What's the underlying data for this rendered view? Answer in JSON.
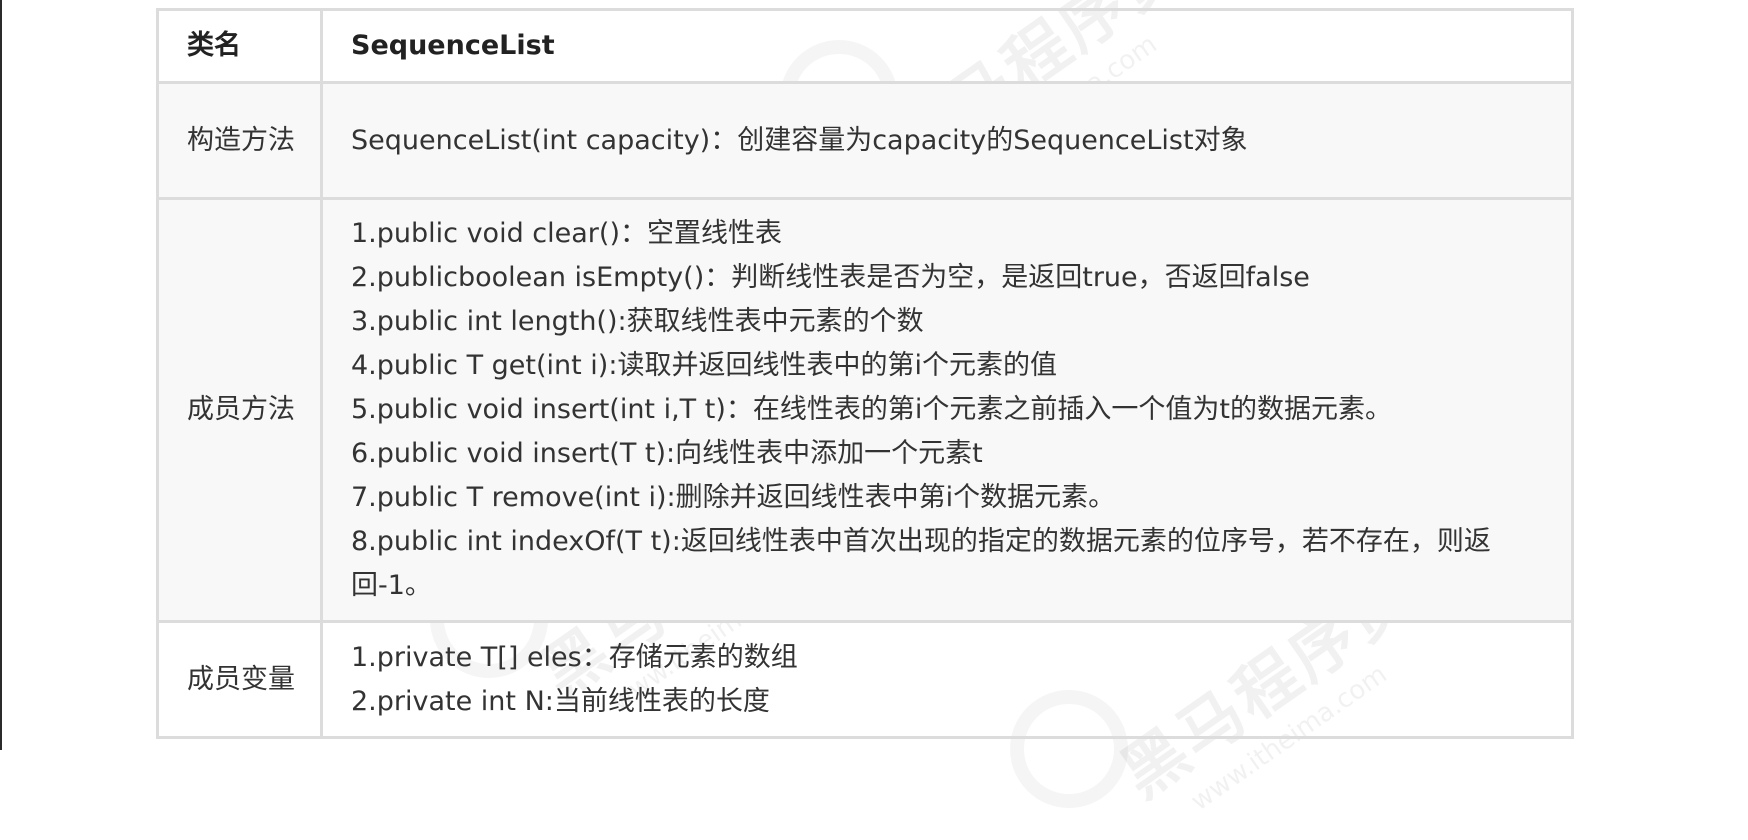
{
  "table": {
    "header": {
      "label": "类名",
      "value": "SequenceList"
    },
    "constructor": {
      "label": "构造方法",
      "value": "SequenceList(int capacity)：创建容量为capacity的SequenceList对象"
    },
    "methods": {
      "label": "成员方法",
      "lines": [
        "1.public void clear()：空置线性表",
        "2.publicboolean isEmpty()：判断线性表是否为空，是返回true，否返回false",
        "3.public int length():获取线性表中元素的个数",
        "4.public T get(int i):读取并返回线性表中的第i个元素的值",
        "5.public void insert(int i,T t)：在线性表的第i个元素之前插入一个值为t的数据元素。",
        "6.public void insert(T t):向线性表中添加一个元素t",
        "7.public T remove(int i):删除并返回线性表中第i个数据元素。",
        "8.public int indexOf(T t):返回线性表中首次出现的指定的数据元素的位序号，若不存在，则返回-1。"
      ]
    },
    "fields": {
      "label": "成员变量",
      "lines": [
        "1.private T[] eles：存储元素的数组",
        "2.private int N:当前线性表的长度"
      ]
    }
  },
  "watermark": {
    "text": "黑马程序员",
    "url": "www.itheima.com"
  }
}
